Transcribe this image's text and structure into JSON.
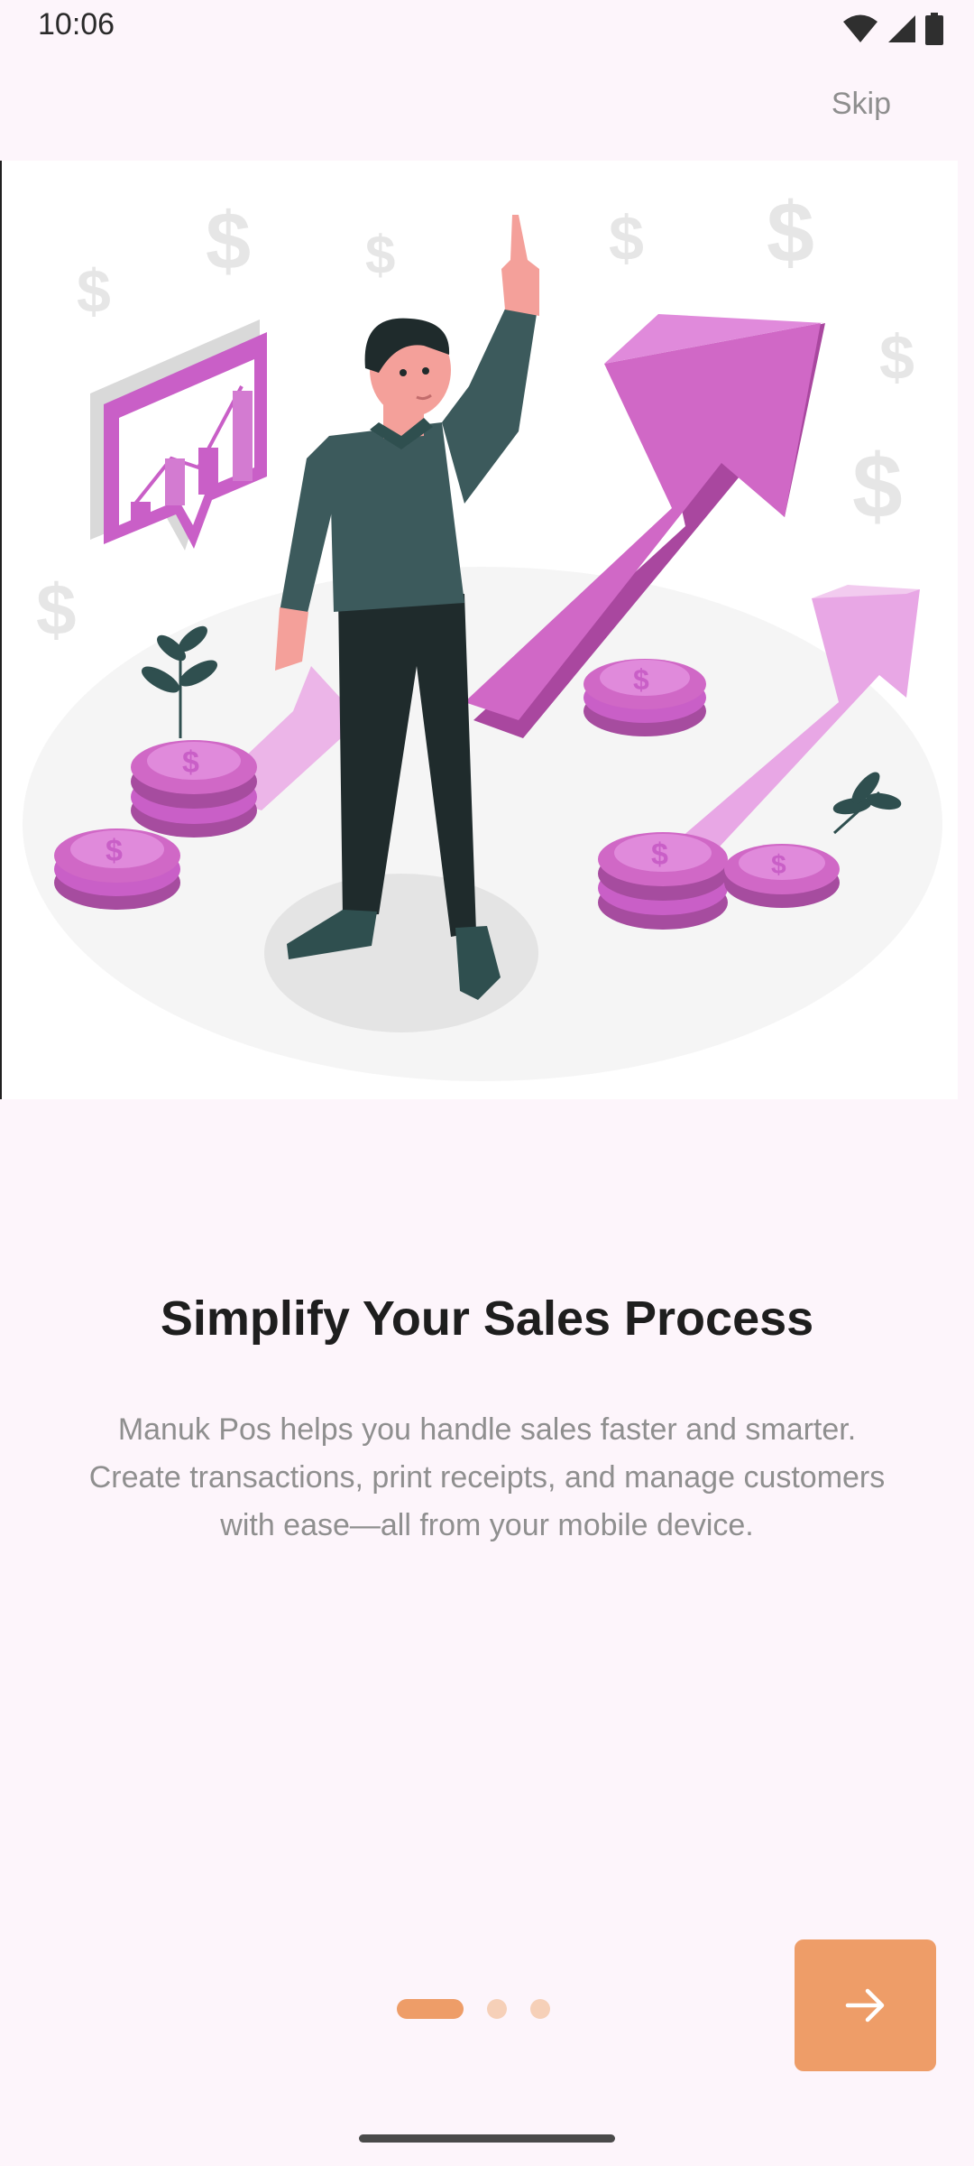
{
  "status_bar": {
    "time": "10:06"
  },
  "header": {
    "skip_label": "Skip"
  },
  "onboarding": {
    "title": "Simplify Your Sales Process",
    "description": "Manuk Pos helps you handle sales faster and smarter. Create transactions, print receipts, and manage customers with ease—all from your mobile device.",
    "page_indicator": {
      "total": 3,
      "active_index": 0
    }
  },
  "colors": {
    "accent": "#EE9D68",
    "accent_light": "#F6D0B8",
    "background": "#FDF5FB",
    "illustration_purple": "#C95FC7"
  },
  "icons": {
    "next": "arrow-right-icon",
    "wifi": "wifi-icon",
    "signal": "signal-icon",
    "battery": "battery-icon"
  }
}
